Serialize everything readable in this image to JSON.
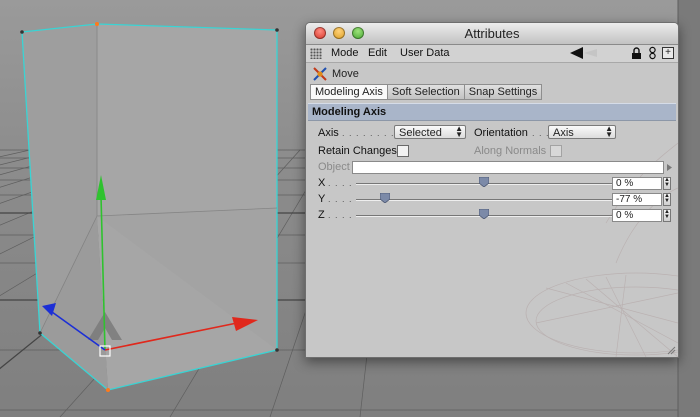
{
  "window": {
    "title": "Attributes",
    "menu": [
      "Mode",
      "Edit",
      "User Data"
    ]
  },
  "object": {
    "name": "Move",
    "icon": "move-tool-icon"
  },
  "tabs": [
    {
      "label": "Modeling Axis",
      "active": true
    },
    {
      "label": "Soft Selection",
      "active": false
    },
    {
      "label": "Snap Settings",
      "active": false
    }
  ],
  "section": {
    "title": "Modeling Axis"
  },
  "fields": {
    "axis": {
      "label": "Axis",
      "value": "Selected"
    },
    "orientation": {
      "label": "Orientation",
      "value": "Axis"
    },
    "retain_changes": {
      "label": "Retain Changes",
      "checked": false
    },
    "along_normals": {
      "label": "Along Normals",
      "checked": false,
      "enabled": false
    },
    "object": {
      "label": "Object",
      "value": ""
    }
  },
  "sliders": [
    {
      "label": "X",
      "value": "0 %",
      "fraction": 0.5
    },
    {
      "label": "Y",
      "value": "-77 %",
      "fraction": 0.115
    },
    {
      "label": "Z",
      "value": "0 %",
      "fraction": 0.5
    }
  ],
  "colors": {
    "section_header": "#a9b5c9",
    "selection_edges": "#39d4d4",
    "axis_x": "#e0281c",
    "axis_y": "#2fc22f",
    "axis_z": "#1c2fd6"
  },
  "icons": [
    "close-icon",
    "minimize-icon",
    "zoom-icon",
    "grip-icon",
    "nav-back-icon",
    "lock-icon",
    "link-icon",
    "add-icon",
    "move-tool-icon"
  ]
}
